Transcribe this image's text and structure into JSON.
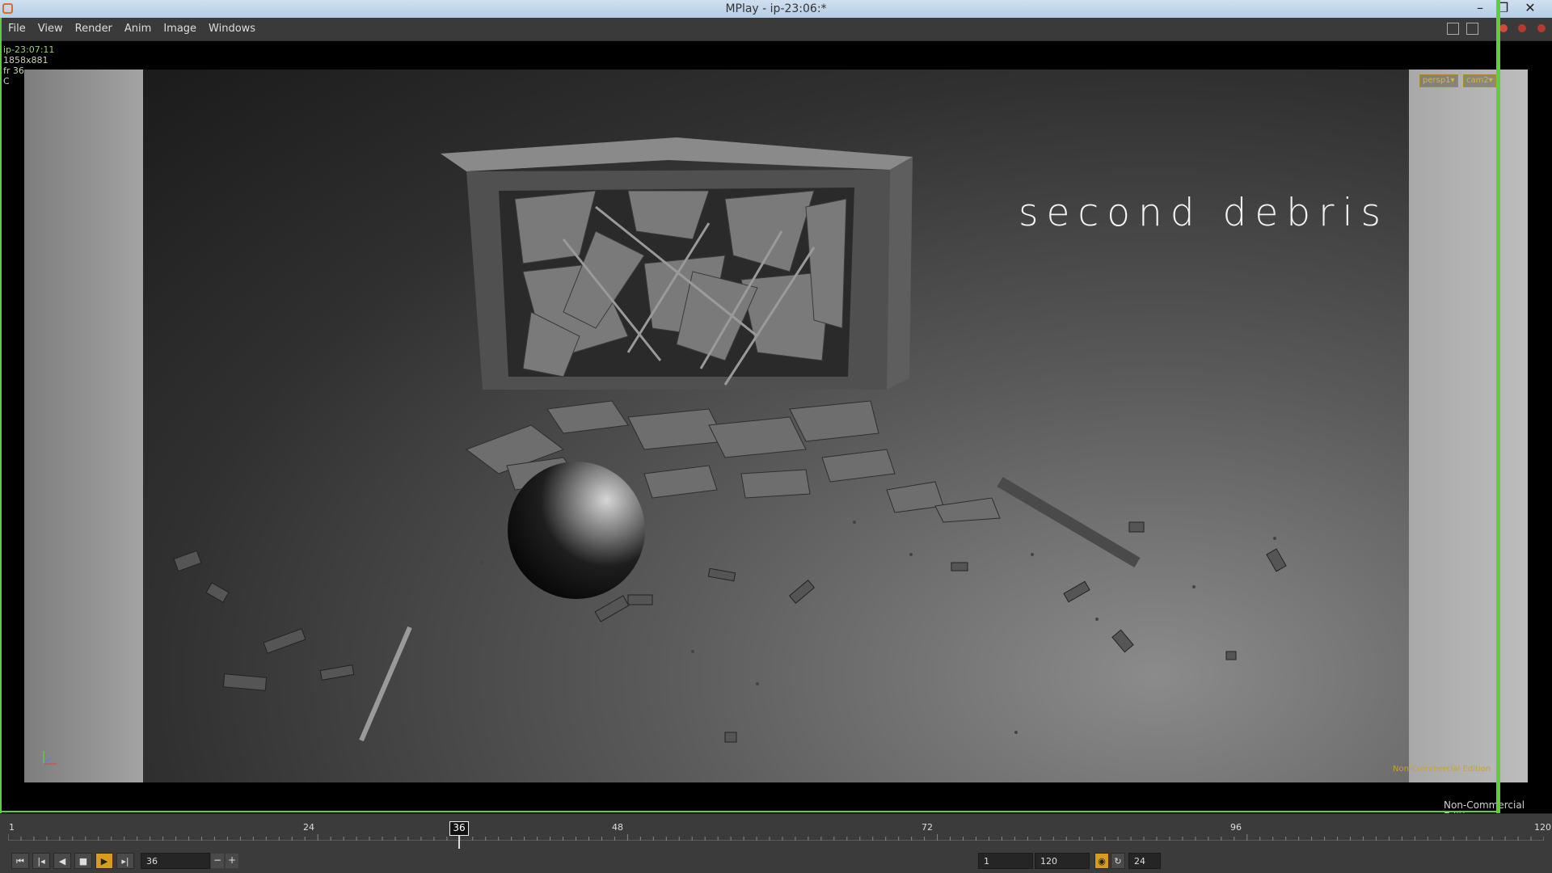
{
  "window": {
    "title": "MPlay - ip-23:06:*",
    "minimize_glyph": "–",
    "restore_glyph": "❐",
    "close_glyph": "✕"
  },
  "menu": [
    "File",
    "View",
    "Render",
    "Anim",
    "Image",
    "Windows"
  ],
  "info": {
    "name": "ip-23:07:11",
    "resolution": "1858x881",
    "frame": "fr 36",
    "channel": "C"
  },
  "viewport": {
    "scene_title": "second debris",
    "camera_left": "persp1▾",
    "camera_right": "cam2▾",
    "watermark_overlay": "Non-Commercial Edition",
    "watermark": "Non-Commercial Edition"
  },
  "timeline": {
    "tick_labels": [
      "1",
      "24",
      "48",
      "72",
      "96",
      "120"
    ],
    "current_frame": "36"
  },
  "playbar": {
    "frame_value": "36",
    "minus": "−",
    "plus": "+",
    "range_start": "1",
    "range_end": "120",
    "fps": "24"
  },
  "icons": {
    "app": "houdini-icon",
    "first": "skip-to-start-icon",
    "prev_key": "step-back-icon",
    "reverse": "play-reverse-icon",
    "stop": "stop-icon",
    "play": "play-forward-icon",
    "next_key": "step-forward-icon",
    "realtime": "realtime-icon",
    "loop": "loop-icon"
  },
  "colors": {
    "accent_green": "#5fce3c",
    "overlay_yellow": "#d1b93a",
    "active_play": "#d89b1c"
  }
}
